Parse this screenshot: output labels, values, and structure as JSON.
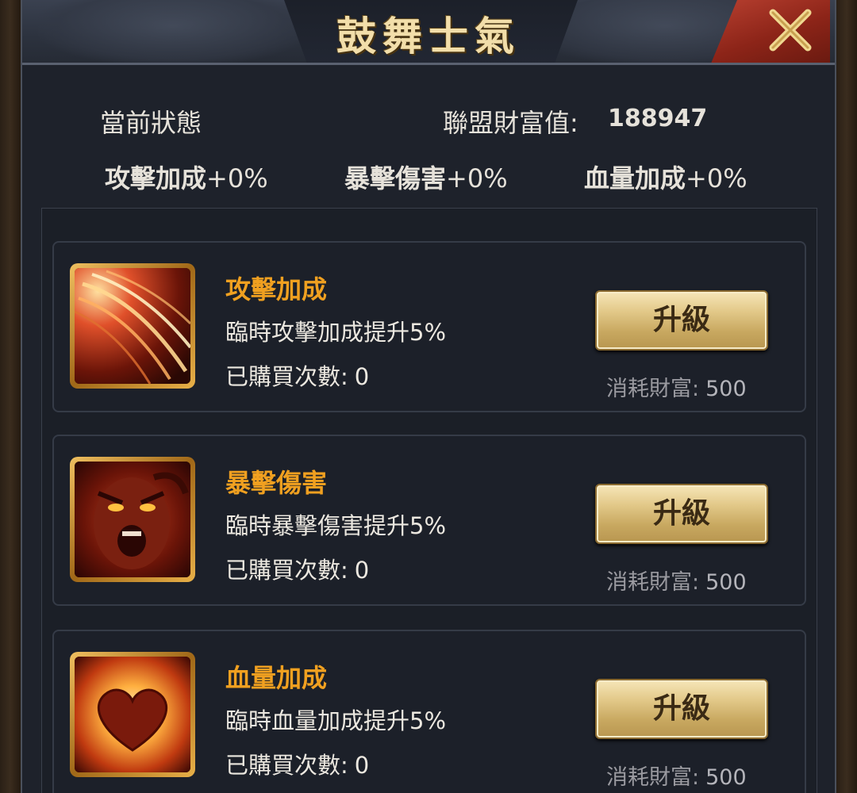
{
  "header": {
    "title": "鼓舞士氣",
    "close_icon": "close-icon"
  },
  "status": {
    "current_label": "當前狀態",
    "wealth_label": "聯盟財富值:",
    "wealth_value": "188947",
    "bonuses": [
      {
        "name": "攻擊加成",
        "value": "+0%"
      },
      {
        "name": "暴擊傷害",
        "value": "+0%"
      },
      {
        "name": "血量加成",
        "value": "+0%"
      }
    ]
  },
  "cards": [
    {
      "icon": "attack-slash-icon",
      "title": "攻擊加成",
      "desc": "臨時攻擊加成提升5%",
      "count_label": "已購買次數:",
      "count": "0",
      "button": "升級",
      "cost_label": "消耗財富:",
      "cost": "500"
    },
    {
      "icon": "rage-face-icon",
      "title": "暴擊傷害",
      "desc": "臨時暴擊傷害提升5%",
      "count_label": "已購買次數:",
      "count": "0",
      "button": "升級",
      "cost_label": "消耗財富:",
      "cost": "500"
    },
    {
      "icon": "heart-glow-icon",
      "title": "血量加成",
      "desc": "臨時血量加成提升5%",
      "count_label": "已購買次數:",
      "count": "0",
      "button": "升級",
      "cost_label": "消耗財富:",
      "cost": "500"
    }
  ],
  "colors": {
    "card_title": "#f0a020",
    "panel_bg": "#1e222b",
    "close_red": "#8c2418",
    "gold_button": "#e2c888"
  }
}
